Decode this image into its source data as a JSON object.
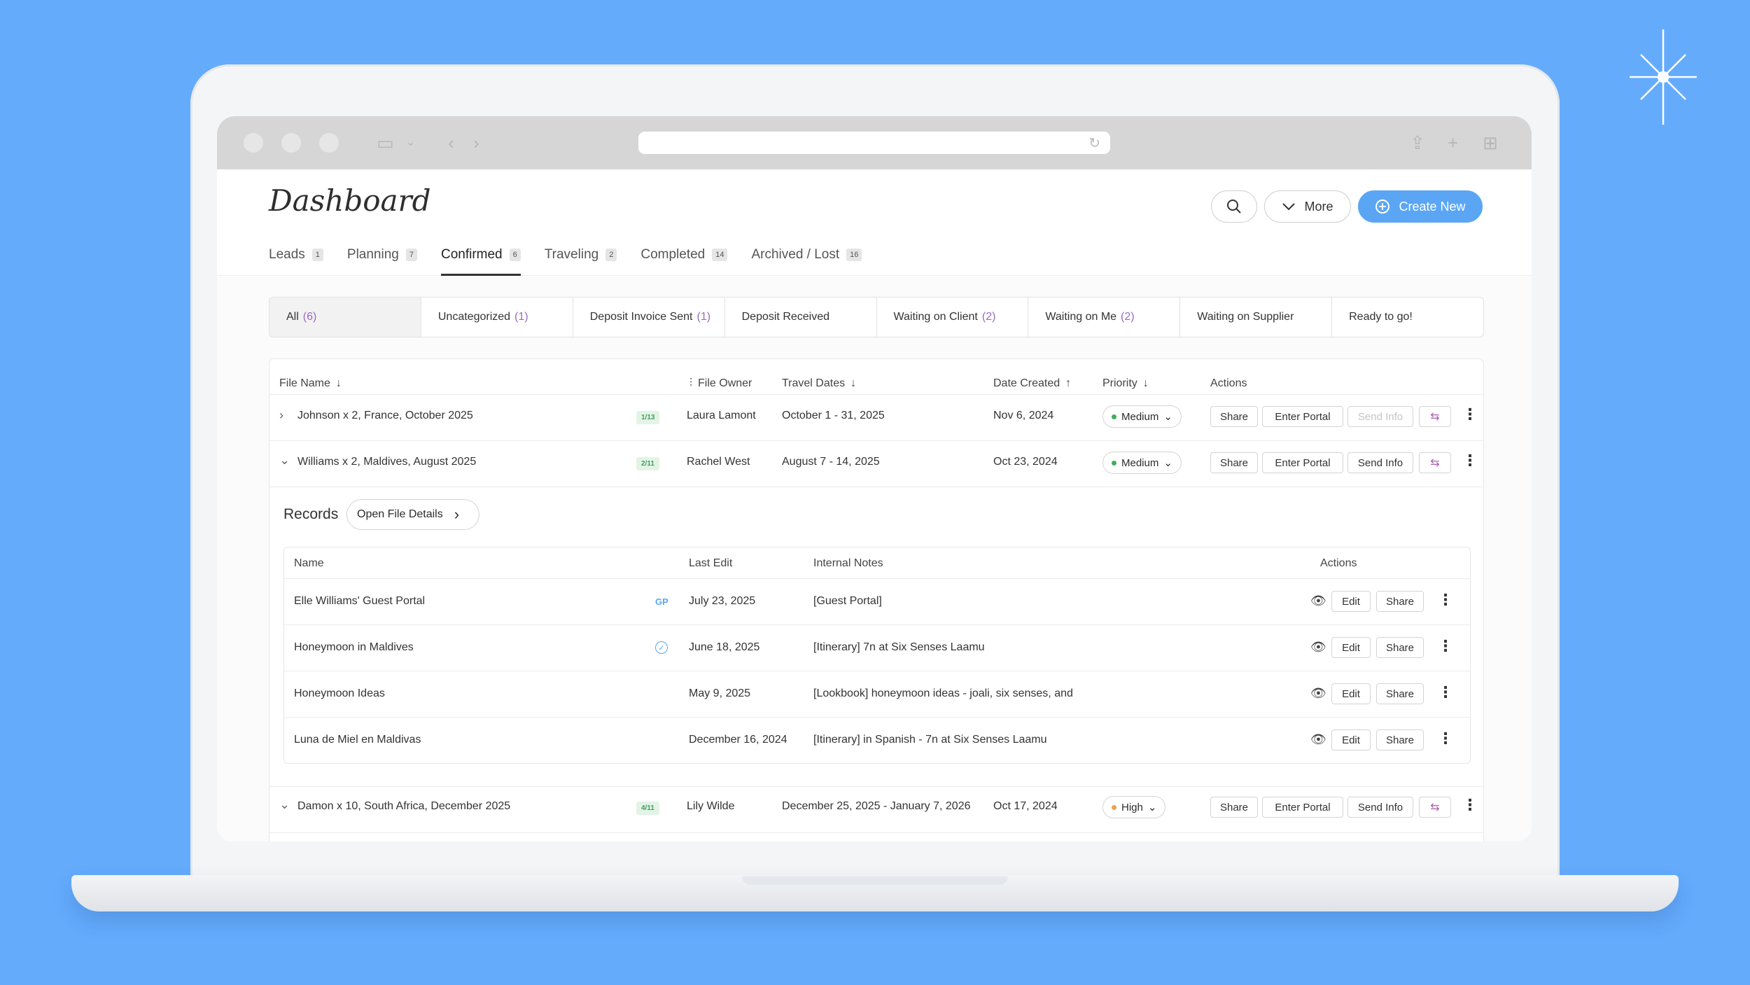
{
  "app": {
    "title": "Dashboard"
  },
  "header": {
    "more_label": "More",
    "create_label": "Create New"
  },
  "tabs": [
    {
      "label": "Leads",
      "count": "1"
    },
    {
      "label": "Planning",
      "count": "7"
    },
    {
      "label": "Confirmed",
      "count": "6"
    },
    {
      "label": "Traveling",
      "count": "2"
    },
    {
      "label": "Completed",
      "count": "14"
    },
    {
      "label": "Archived / Lost",
      "count": "16"
    }
  ],
  "filters": [
    {
      "label": "All",
      "count": "(6)"
    },
    {
      "label": "Uncategorized",
      "count": "(1)"
    },
    {
      "label": "Deposit Invoice Sent",
      "count": "(1)"
    },
    {
      "label": "Deposit Received",
      "count": ""
    },
    {
      "label": "Waiting on Client",
      "count": "(2)"
    },
    {
      "label": "Waiting on Me",
      "count": "(2)"
    },
    {
      "label": "Waiting on Supplier",
      "count": ""
    },
    {
      "label": "Ready to go!",
      "count": ""
    }
  ],
  "table": {
    "headers": {
      "file_name": "File Name",
      "file_owner": "File Owner",
      "travel_dates": "Travel Dates",
      "date_created": "Date Created",
      "priority": "Priority",
      "actions": "Actions"
    },
    "rows": [
      {
        "name": "Johnson x 2, France, October 2025",
        "progress": "1/13",
        "owner": "Laura Lamont",
        "dates": "October 1 - 31, 2025",
        "created": "Nov 6, 2024",
        "priority": "Medium",
        "share": "Share",
        "portal": "Enter Portal",
        "send": "Send Info"
      },
      {
        "name": "Williams x 2, Maldives, August 2025",
        "progress": "2/11",
        "owner": "Rachel West",
        "dates": "August 7 - 14, 2025",
        "created": "Oct 23, 2024",
        "priority": "Medium",
        "share": "Share",
        "portal": "Enter Portal",
        "send": "Send Info"
      },
      {
        "name": "Damon x 10, South Africa, December 2025",
        "progress": "4/11",
        "owner": "Lily Wilde",
        "dates": "December 25, 2025 - January 7, 2026",
        "created": "Oct 17, 2024",
        "priority": "High",
        "share": "Share",
        "portal": "Enter Portal",
        "send": "Send Info"
      }
    ]
  },
  "records": {
    "title": "Records",
    "open_details_label": "Open File Details",
    "headers": {
      "name": "Name",
      "last_edit": "Last Edit",
      "notes": "Internal Notes",
      "actions": "Actions"
    },
    "rows": [
      {
        "name": "Elle Williams' Guest Portal",
        "badge": "GP",
        "last_edit": "July 23, 2025",
        "notes": "[Guest Portal]",
        "edit": "Edit",
        "share": "Share"
      },
      {
        "name": "Honeymoon in Maldives",
        "badge": "",
        "last_edit": "June 18, 2025",
        "notes": "[Itinerary] 7n at Six Senses Laamu",
        "edit": "Edit",
        "share": "Share"
      },
      {
        "name": "Honeymoon Ideas",
        "badge": "",
        "last_edit": "May 9, 2025",
        "notes": "[Lookbook] honeymoon ideas - joali, six senses, and",
        "edit": "Edit",
        "share": "Share"
      },
      {
        "name": "Luna de Miel en Maldivas",
        "badge": "",
        "last_edit": "December 16, 2024",
        "notes": "[Itinerary] in Spanish - 7n at Six Senses Laamu",
        "edit": "Edit",
        "share": "Share"
      }
    ]
  },
  "colors": {
    "background": "#64abfc",
    "accent": "#5aa6f4",
    "progress_green": "#3f9e5c",
    "medium_dot": "#3fae5a",
    "high_dot": "#f0a24a",
    "count_purple": "#9b6abf"
  },
  "icons": [
    "sparkle-icon",
    "sidebar-icon",
    "back-icon",
    "forward-icon",
    "reload-icon",
    "share-icon",
    "plus-icon",
    "tabs-icon",
    "search-icon",
    "chevron-down-icon",
    "plus-circle-icon",
    "sort-icon",
    "filter-icon",
    "swap-icon",
    "kebab-icon",
    "eye-icon",
    "check-icon",
    "chevron-right-icon"
  ]
}
